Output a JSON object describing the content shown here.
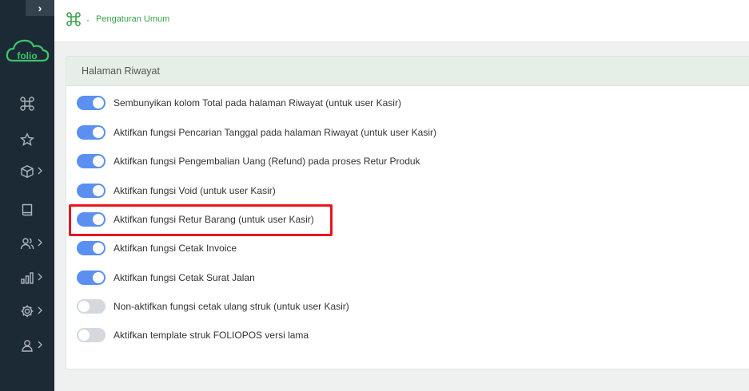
{
  "sidebar": {
    "collapse_symbol": "›",
    "logo_text": "folio",
    "items": [
      {
        "icon": "command-icon",
        "has_submenu": false
      },
      {
        "icon": "star-icon",
        "has_submenu": false
      },
      {
        "icon": "box-icon",
        "has_submenu": true
      },
      {
        "icon": "book-icon",
        "has_submenu": false
      },
      {
        "icon": "users-icon",
        "has_submenu": true
      },
      {
        "icon": "bar-chart-icon",
        "has_submenu": true
      },
      {
        "icon": "gear-icon",
        "has_submenu": true
      },
      {
        "icon": "user-icon",
        "has_submenu": true
      }
    ]
  },
  "breadcrumb": {
    "separator": "·",
    "current": "Pengaturan Umum"
  },
  "card": {
    "title": "Halaman Riwayat",
    "toggles": [
      {
        "label": "Sembunyikan kolom Total pada halaman Riwayat (untuk user Kasir)",
        "on": true
      },
      {
        "label": "Aktifkan fungsi Pencarian Tanggal pada halaman Riwayat (untuk user Kasir)",
        "on": true
      },
      {
        "label": "Aktifkan fungsi Pengembalian Uang (Refund) pada proses Retur Produk",
        "on": true
      },
      {
        "label": "Aktifkan fungsi Void (untuk user Kasir)",
        "on": true
      },
      {
        "label": "Aktifkan fungsi Retur Barang (untuk user Kasir)",
        "on": true
      },
      {
        "label": "Aktifkan fungsi Cetak Invoice",
        "on": true
      },
      {
        "label": "Aktifkan fungsi Cetak Surat Jalan",
        "on": true
      },
      {
        "label": "Non-aktifkan fungsi cetak ulang struk (untuk user Kasir)",
        "on": false
      },
      {
        "label": "Aktifkan template struk FOLIOPOS versi lama",
        "on": false
      }
    ]
  },
  "colors": {
    "accent_green": "#3aa14a",
    "toggle_on": "#5b8ff0",
    "toggle_off": "#d5d8dc",
    "highlight": "#e8161e"
  }
}
